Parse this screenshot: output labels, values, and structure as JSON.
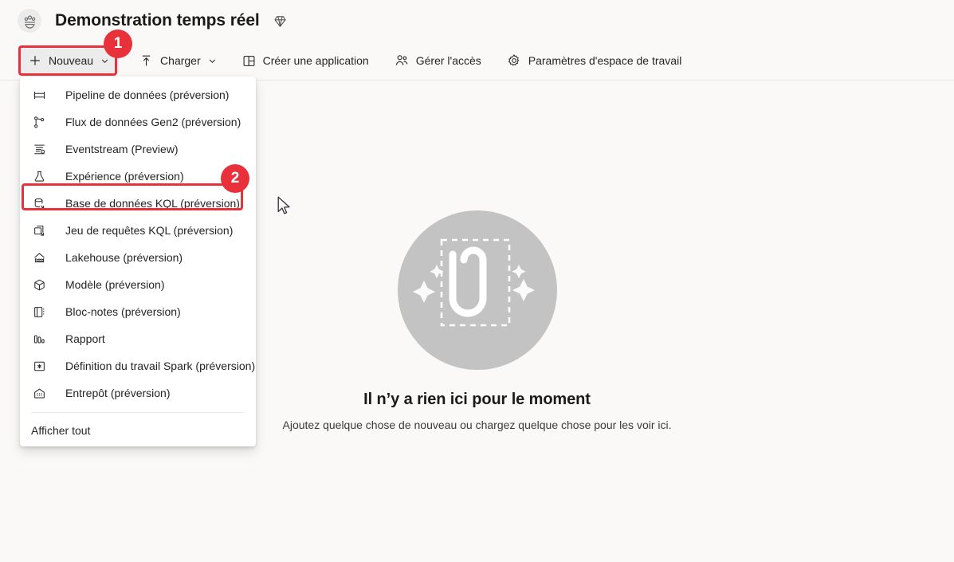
{
  "header": {
    "workspace_icon": "people-group-icon",
    "title": "Demonstration temps réel",
    "capacity_icon": "diamond-icon"
  },
  "toolbar": {
    "new_label": "Nouveau",
    "new_icon": "plus-icon",
    "new_chevron_icon": "chevron-down-icon",
    "upload_label": "Charger",
    "upload_icon": "upload-arrow-icon",
    "upload_chevron_icon": "chevron-down-icon",
    "create_app_label": "Créer une application",
    "create_app_icon": "app-grid-icon",
    "manage_access_label": "Gérer l'accès",
    "manage_access_icon": "people-icon",
    "settings_label": "Paramètres d'espace de travail",
    "settings_icon": "gear-icon"
  },
  "menu": {
    "items": [
      {
        "label": "Pipeline de données (préversion)",
        "icon": "data-pipeline-icon"
      },
      {
        "label": "Flux de données Gen2 (préversion)",
        "icon": "dataflow-icon"
      },
      {
        "label": "Eventstream (Preview)",
        "icon": "eventstream-icon"
      },
      {
        "label": "Expérience (préversion)",
        "icon": "flask-experiment-icon"
      },
      {
        "label": "Base de données KQL (préversion)",
        "icon": "kql-database-icon"
      },
      {
        "label": "Jeu de requêtes KQL (préversion)",
        "icon": "kql-queryset-icon"
      },
      {
        "label": "Lakehouse (préversion)",
        "icon": "lakehouse-icon"
      },
      {
        "label": "Modèle (préversion)",
        "icon": "dataset-cube-icon"
      },
      {
        "label": "Bloc-notes (préversion)",
        "icon": "notebook-icon"
      },
      {
        "label": "Rapport",
        "icon": "report-bars-icon"
      },
      {
        "label": "Définition du travail Spark (préversion)",
        "icon": "spark-job-icon"
      },
      {
        "label": "Entrepôt (préversion)",
        "icon": "warehouse-icon"
      }
    ],
    "show_all_label": "Afficher tout"
  },
  "annotations": {
    "badge_1": "1",
    "badge_2": "2",
    "highlight_color": "#e8313a"
  },
  "empty_state": {
    "illustration": "paperclip-dashed-frame-illustration",
    "title": "Il n’y a rien ici pour le moment",
    "subtitle": "Ajoutez quelque chose de nouveau ou chargez quelque chose pour les voir ici."
  },
  "cursor": {
    "icon": "mouse-pointer-icon"
  }
}
